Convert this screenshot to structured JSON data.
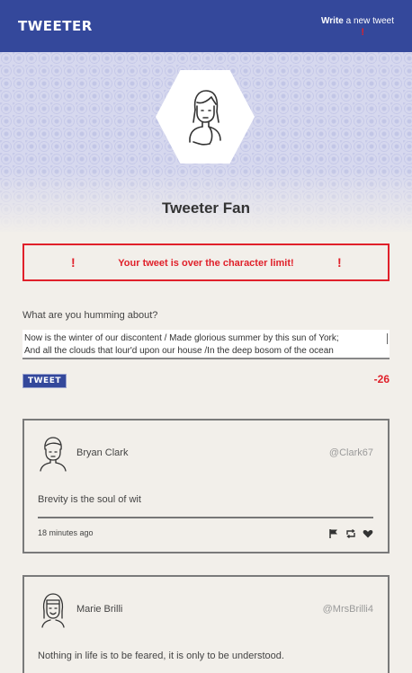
{
  "header": {
    "logo": "TWEETER",
    "write_bold": "Write",
    "write_rest": " a new tweet",
    "write_alert": "!"
  },
  "profile": {
    "name": "Tweeter Fan"
  },
  "error": {
    "icon_left": "!",
    "message": "Your tweet is over the character limit!",
    "icon_right": "!"
  },
  "compose": {
    "prompt": "What are you humming about?",
    "line1": "Now is the winter of our discontent / Made glorious summer by this sun of York;",
    "line2": "And all the clouds that lour'd upon our house /In the deep bosom of the ocean",
    "button_label": "TWEET",
    "char_count": "-26"
  },
  "tweets": [
    {
      "name": "Bryan Clark",
      "handle": "@Clark67",
      "text": "Brevity is the soul of wit",
      "time": "18 minutes ago"
    },
    {
      "name": "Marie Brilli",
      "handle": "@MrsBrilli4",
      "text": "Nothing in life is to be feared, it is only to be understood."
    }
  ],
  "colors": {
    "brand": "#34489b",
    "error": "#e0202a",
    "background": "#f2efea"
  }
}
